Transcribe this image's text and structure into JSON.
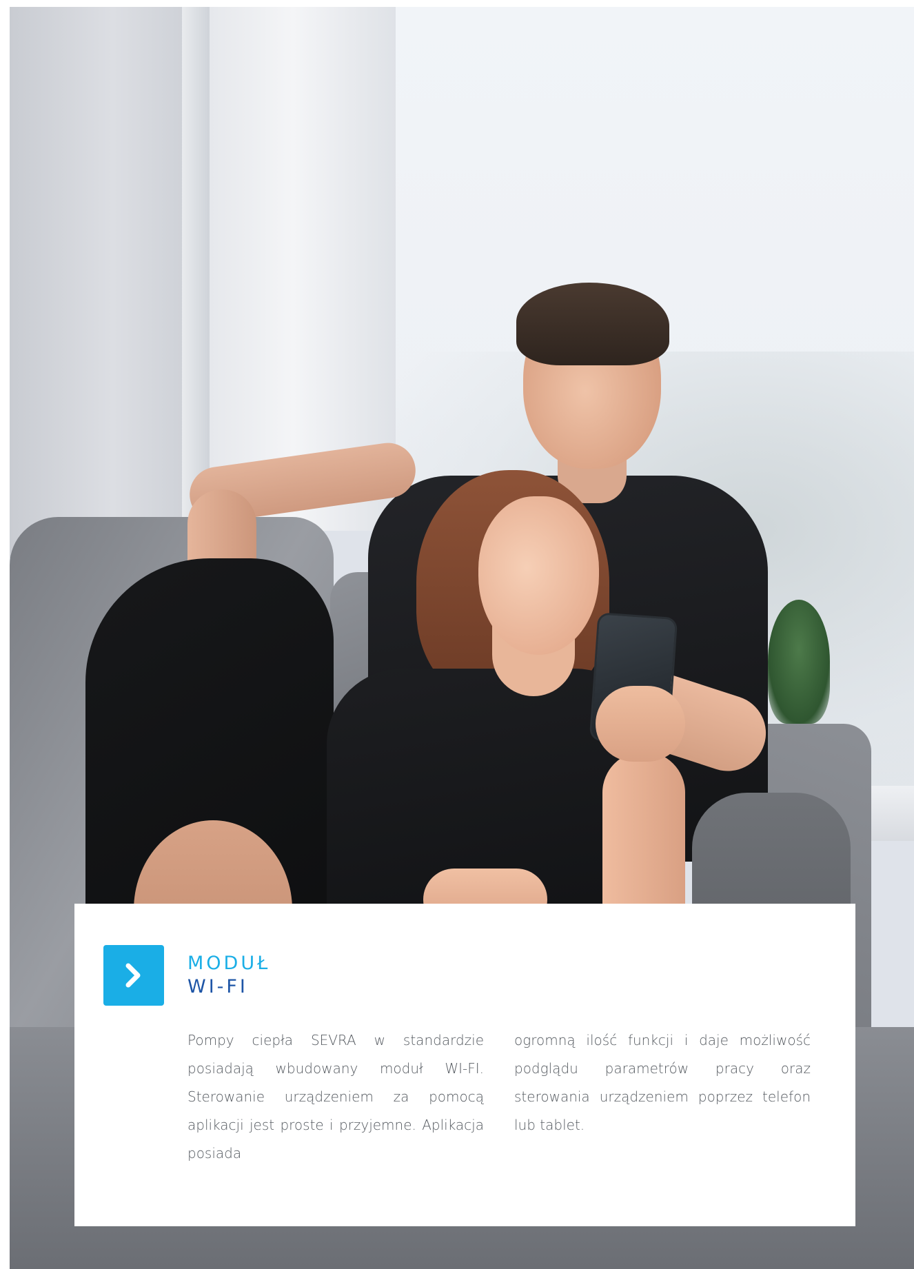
{
  "card": {
    "title_line_1": "MODUŁ",
    "title_line_2": "WI-FI",
    "column_1": "Pompy ciepła SEVRA w standardzie posiadają wbudowany moduł WI-FI. Sterowanie urządzeniem za pomocą aplikacji jest proste i przyjemne. Aplikacja posiada",
    "column_2": "ogromną ilość funkcji i daje możliwość podglądu parametrów pracy oraz sterowania urządzeniem poprzez telefon lub tablet.",
    "icon": "chevron-right-icon"
  },
  "colors": {
    "accent_light": "#1aaee6",
    "accent_dark": "#1e55a6",
    "body_text": "#555a60"
  }
}
